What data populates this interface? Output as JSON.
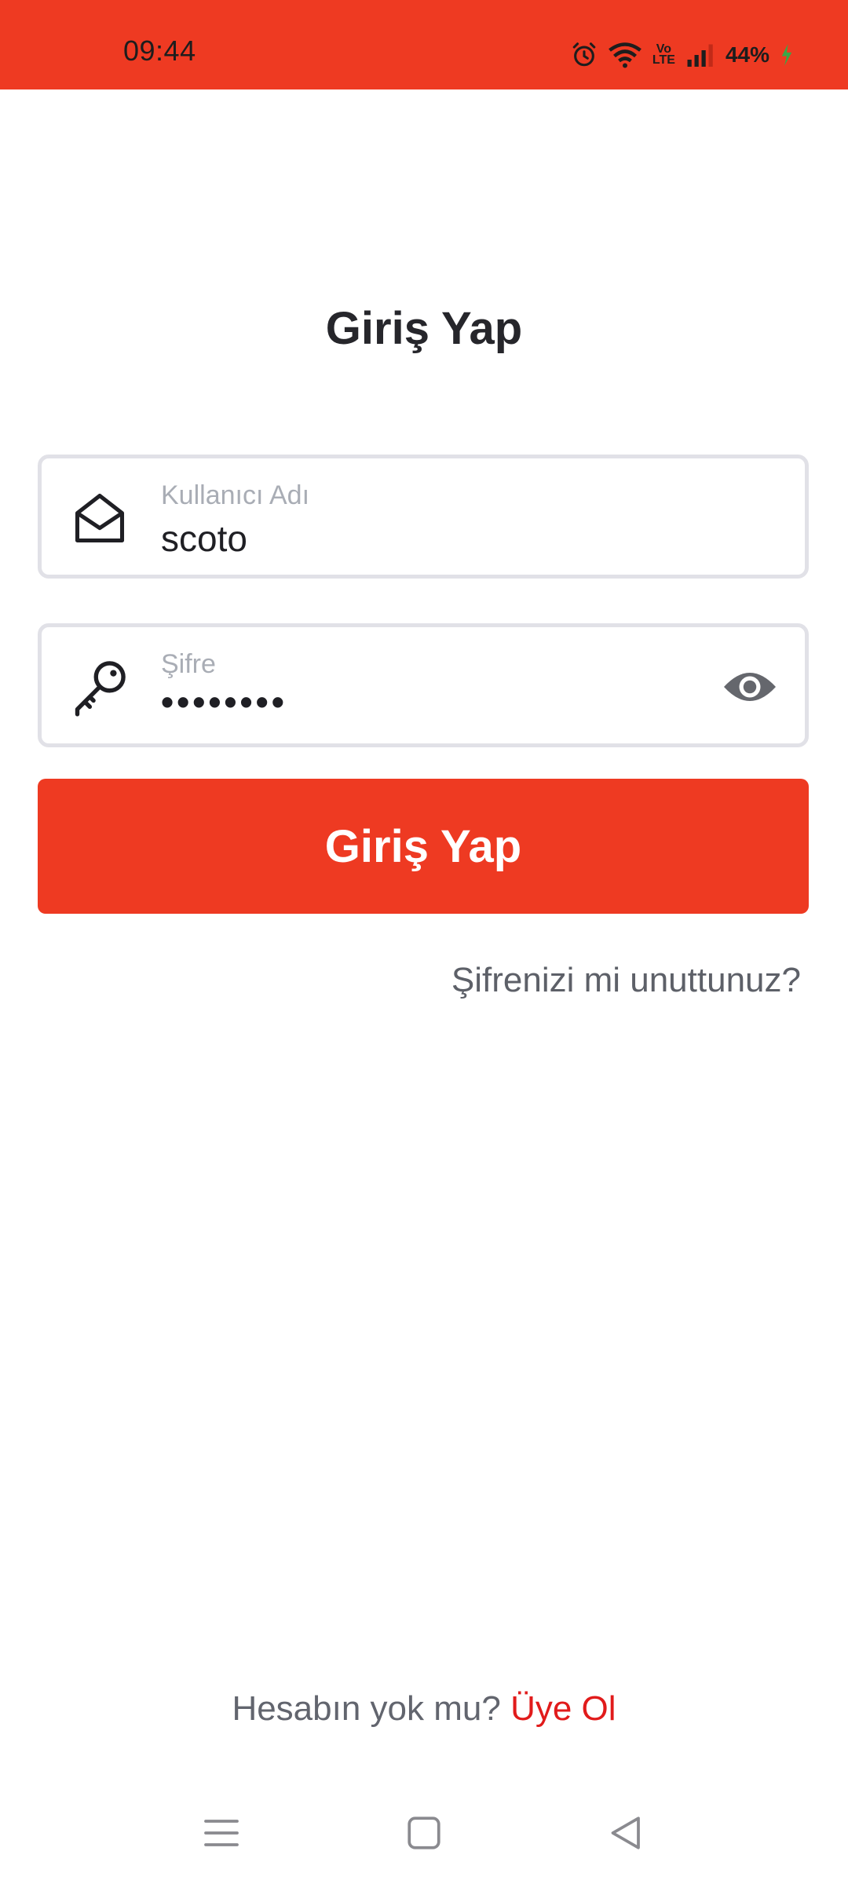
{
  "status_bar": {
    "time": "09:44",
    "battery": "44%",
    "volte": [
      "Vo",
      "LTE"
    ],
    "icons": [
      "alarm-icon",
      "wifi-icon",
      "volte-icon",
      "signal-icon",
      "battery-charging-icon"
    ]
  },
  "page": {
    "title": "Giriş Yap"
  },
  "form": {
    "username": {
      "label": "Kullanıcı Adı",
      "value": "scoto",
      "icon": "envelope-open-icon"
    },
    "password": {
      "label": "Şifre",
      "value": "••••••••",
      "icon": "key-icon",
      "toggle_icon": "eye-icon"
    },
    "submit_label": "Giriş Yap",
    "forgot_label": "Şifrenizi mi unuttunuz?"
  },
  "footer": {
    "question": "Hesabın yok mu?",
    "signup_label": "Üye Ol"
  },
  "nav": {
    "icons": [
      "menu-icon",
      "home-square-icon",
      "back-triangle-icon"
    ]
  },
  "colors": {
    "brand": "#ee3a22",
    "link_red": "#e11b1b",
    "muted_text": "#5d6068",
    "field_border": "#e1e1e7"
  }
}
